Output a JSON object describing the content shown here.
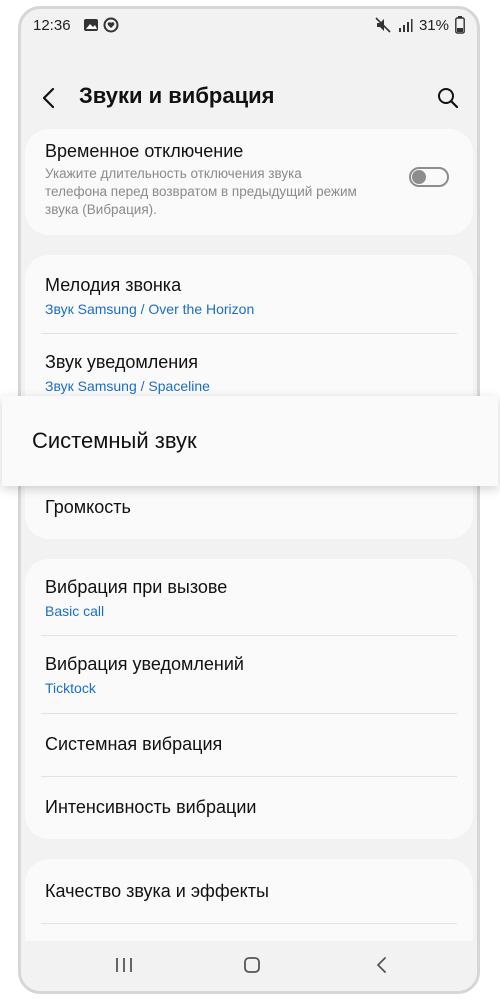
{
  "status": {
    "time": "12:36",
    "battery": "31%"
  },
  "header": {
    "title": "Звуки и вибрация"
  },
  "temp_mute": {
    "title": "Временное отключение",
    "desc": "Укажите длительность отключения звука телефона перед возвратом в предыдущий режим звука (Вибрация).",
    "enabled": false
  },
  "sound_items": [
    {
      "title": "Мелодия звонка",
      "sub": "Звук Samsung / Over the Horizon"
    },
    {
      "title": "Звук уведомления",
      "sub": "Звук Samsung / Spaceline"
    },
    {
      "title": "Громкость"
    }
  ],
  "highlight": {
    "title": "Системный звук"
  },
  "vibration_items": [
    {
      "title": "Вибрация при вызове",
      "sub": "Basic call"
    },
    {
      "title": "Вибрация уведомлений",
      "sub": "Ticktock"
    },
    {
      "title": "Системная вибрация"
    },
    {
      "title": "Интенсивность вибрации"
    }
  ],
  "quality_items": [
    {
      "title": "Качество звука и эффекты"
    }
  ]
}
